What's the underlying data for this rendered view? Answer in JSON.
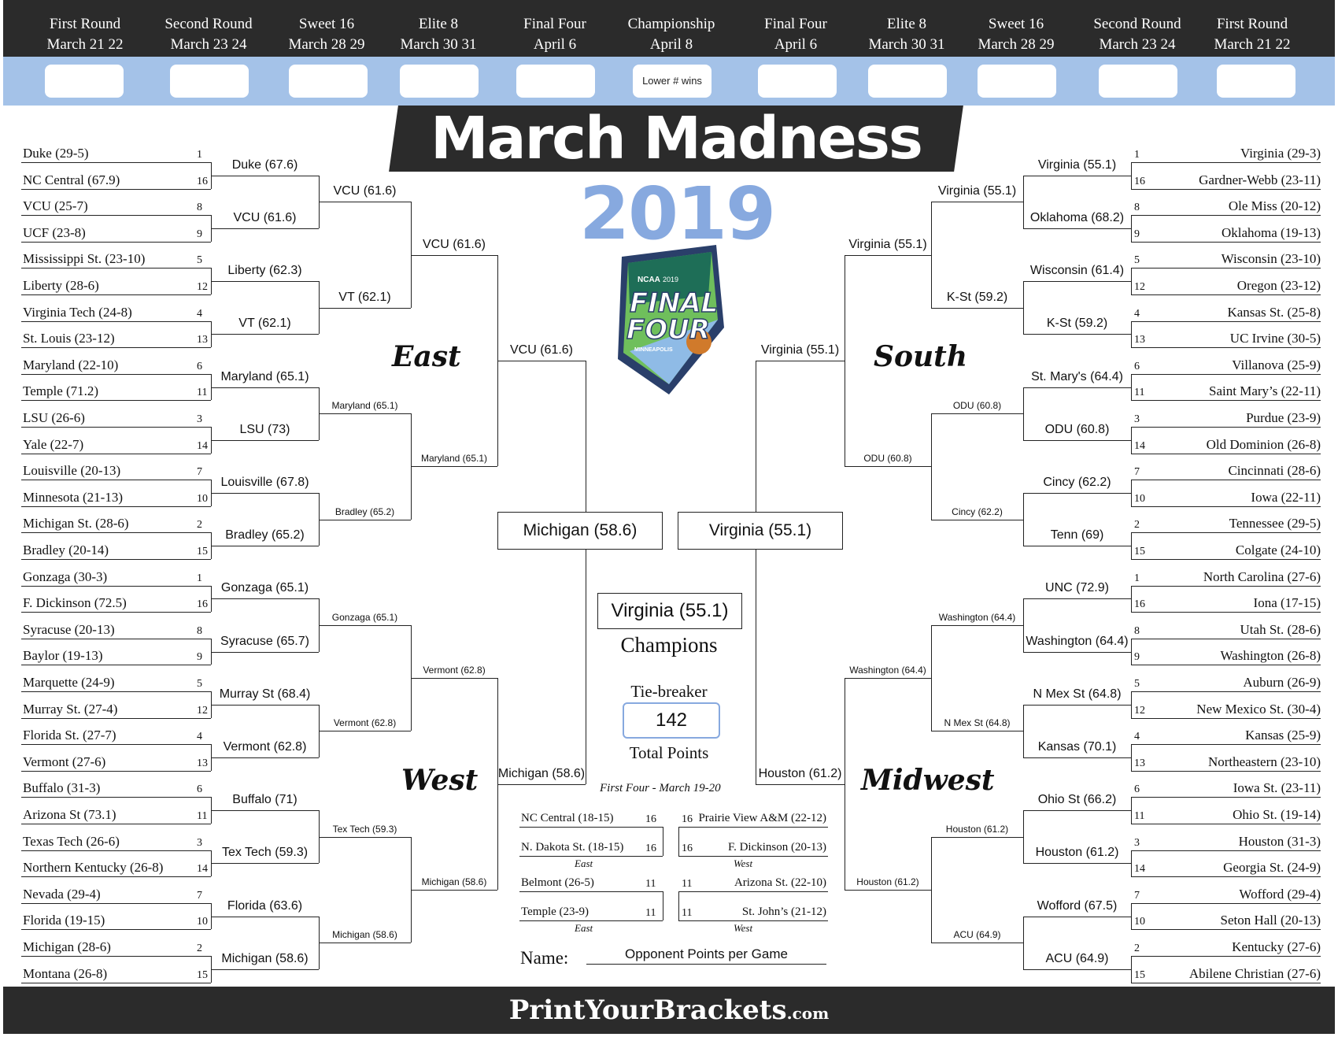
{
  "header": {
    "rounds_left": [
      {
        "name": "First Round",
        "dates": "March 21 22"
      },
      {
        "name": "Second Round",
        "dates": "March 23 24"
      },
      {
        "name": "Sweet 16",
        "dates": "March 28 29"
      },
      {
        "name": "Elite 8",
        "dates": "March 30 31"
      },
      {
        "name": "Final Four",
        "dates": "April 6"
      }
    ],
    "championship": {
      "name": "Championship",
      "dates": "April 8",
      "box_label": "Lower # wins"
    },
    "rounds_right": [
      {
        "name": "Final Four",
        "dates": "April 6"
      },
      {
        "name": "Elite 8",
        "dates": "March 30 31"
      },
      {
        "name": "Sweet 16",
        "dates": "March 28 29"
      },
      {
        "name": "Second Round",
        "dates": "March 23 24"
      },
      {
        "name": "First Round",
        "dates": "March 21 22"
      }
    ]
  },
  "title": {
    "main": "March Madness",
    "year": "2019"
  },
  "logo": {
    "line1": "NCAA",
    "line2": "2019",
    "line3": "FINAL",
    "line4": "FOUR",
    "line5": "MINNEAPOLIS"
  },
  "regions": {
    "east": "East",
    "south": "South",
    "west": "West",
    "midwest": "Midwest"
  },
  "left_teams": [
    {
      "t": "Duke (29-5)",
      "s": "1"
    },
    {
      "t": "NC Central (67.9)",
      "s": "16"
    },
    {
      "t": "VCU (25-7)",
      "s": "8"
    },
    {
      "t": "UCF (23-8)",
      "s": "9"
    },
    {
      "t": "Mississippi St. (23-10)",
      "s": "5"
    },
    {
      "t": "Liberty (28-6)",
      "s": "12"
    },
    {
      "t": "Virginia Tech (24-8)",
      "s": "4"
    },
    {
      "t": "St. Louis (23-12)",
      "s": "13"
    },
    {
      "t": "Maryland (22-10)",
      "s": "6"
    },
    {
      "t": "Temple (71.2)",
      "s": "11"
    },
    {
      "t": "LSU (26-6)",
      "s": "3"
    },
    {
      "t": "Yale (22-7)",
      "s": "14"
    },
    {
      "t": "Louisville (20-13)",
      "s": "7"
    },
    {
      "t": "Minnesota (21-13)",
      "s": "10"
    },
    {
      "t": "Michigan St. (28-6)",
      "s": "2"
    },
    {
      "t": "Bradley (20-14)",
      "s": "15"
    },
    {
      "t": "Gonzaga (30-3)",
      "s": "1"
    },
    {
      "t": "F. Dickinson (72.5)",
      "s": "16"
    },
    {
      "t": "Syracuse (20-13)",
      "s": "8"
    },
    {
      "t": "Baylor (19-13)",
      "s": "9"
    },
    {
      "t": "Marquette (24-9)",
      "s": "5"
    },
    {
      "t": "Murray St. (27-4)",
      "s": "12"
    },
    {
      "t": "Florida St. (27-7)",
      "s": "4"
    },
    {
      "t": "Vermont (27-6)",
      "s": "13"
    },
    {
      "t": "Buffalo (31-3)",
      "s": "6"
    },
    {
      "t": "Arizona St (73.1)",
      "s": "11"
    },
    {
      "t": "Texas Tech (26-6)",
      "s": "3"
    },
    {
      "t": "Northern Kentucky (26-8)",
      "s": "14"
    },
    {
      "t": "Nevada (29-4)",
      "s": "7"
    },
    {
      "t": "Florida (19-15)",
      "s": "10"
    },
    {
      "t": "Michigan (28-6)",
      "s": "2"
    },
    {
      "t": "Montana (26-8)",
      "s": "15"
    }
  ],
  "right_teams": [
    {
      "t": "Virginia (29-3)",
      "s": "1"
    },
    {
      "t": "Gardner-Webb (23-11)",
      "s": "16"
    },
    {
      "t": "Ole Miss (20-12)",
      "s": "8"
    },
    {
      "t": "Oklahoma (19-13)",
      "s": "9"
    },
    {
      "t": "Wisconsin (23-10)",
      "s": "5"
    },
    {
      "t": "Oregon (23-12)",
      "s": "12"
    },
    {
      "t": "Kansas St. (25-8)",
      "s": "4"
    },
    {
      "t": "UC Irvine (30-5)",
      "s": "13"
    },
    {
      "t": "Villanova (25-9)",
      "s": "6"
    },
    {
      "t": "Saint Mary’s (22-11)",
      "s": "11"
    },
    {
      "t": "Purdue (23-9)",
      "s": "3"
    },
    {
      "t": "Old Dominion (26-8)",
      "s": "14"
    },
    {
      "t": "Cincinnati (28-6)",
      "s": "7"
    },
    {
      "t": "Iowa (22-11)",
      "s": "10"
    },
    {
      "t": "Tennessee (29-5)",
      "s": "2"
    },
    {
      "t": "Colgate (24-10)",
      "s": "15"
    },
    {
      "t": "North Carolina (27-6)",
      "s": "1"
    },
    {
      "t": "Iona (17-15)",
      "s": "16"
    },
    {
      "t": "Utah St. (28-6)",
      "s": "8"
    },
    {
      "t": "Washington (26-8)",
      "s": "9"
    },
    {
      "t": "Auburn (26-9)",
      "s": "5"
    },
    {
      "t": "New Mexico St. (30-4)",
      "s": "12"
    },
    {
      "t": "Kansas (25-9)",
      "s": "4"
    },
    {
      "t": "Northeastern (23-10)",
      "s": "13"
    },
    {
      "t": "Iowa St. (23-11)",
      "s": "6"
    },
    {
      "t": "Ohio St. (19-14)",
      "s": "11"
    },
    {
      "t": "Houston (31-3)",
      "s": "3"
    },
    {
      "t": "Georgia St. (24-9)",
      "s": "14"
    },
    {
      "t": "Wofford (29-4)",
      "s": "7"
    },
    {
      "t": "Seton Hall (20-13)",
      "s": "10"
    },
    {
      "t": "Kentucky (27-6)",
      "s": "2"
    },
    {
      "t": "Abilene Christian (27-6)",
      "s": "15"
    }
  ],
  "left_r2": [
    "Duke (67.6)",
    "VCU (61.6)",
    "Liberty (62.3)",
    "VT (62.1)",
    "Maryland (65.1)",
    "LSU (73)",
    "Louisville (67.8)",
    "Bradley (65.2)",
    "Gonzaga (65.1)",
    "Syracuse (65.7)",
    "Murray St (68.4)",
    "Vermont (62.8)",
    "Buffalo (71)",
    "Tex Tech (59.3)",
    "Florida (63.6)",
    "Michigan (58.6)"
  ],
  "left_r3": [
    "VCU (61.6)",
    "VT (62.1)",
    "Maryland (65.1)",
    "Bradley (65.2)",
    "Gonzaga (65.1)",
    "Vermont (62.8)",
    "Tex Tech (59.3)",
    "Michigan (58.6)"
  ],
  "left_r4": [
    "VCU (61.6)",
    "Maryland (65.1)",
    "Vermont (62.8)",
    "Michigan (58.6)"
  ],
  "left_r5": [
    "VCU (61.6)",
    "Michigan (58.6)"
  ],
  "right_r2": [
    "Virginia (55.1)",
    "Oklahoma (68.2)",
    "Wisconsin (61.4)",
    "K-St (59.2)",
    "St. Mary's (64.4)",
    "ODU (60.8)",
    "Cincy (62.2)",
    "Tenn (69)",
    "UNC (72.9)",
    "Washington (64.4)",
    "N Mex St (64.8)",
    "Kansas (70.1)",
    "Ohio St (66.2)",
    "Houston (61.2)",
    "Wofford (67.5)",
    "ACU (64.9)"
  ],
  "right_r3": [
    "Virginia (55.1)",
    "K-St (59.2)",
    "ODU (60.8)",
    "Cincy (62.2)",
    "Washington (64.4)",
    "N Mex St (64.8)",
    "Houston (61.2)",
    "ACU (64.9)"
  ],
  "right_r4": [
    "Virginia (55.1)",
    "ODU (60.8)",
    "Washington (64.4)",
    "Houston (61.2)"
  ],
  "right_r5": [
    "Virginia (55.1)",
    "Houston (61.2)"
  ],
  "final": {
    "left": "Michigan (58.6)",
    "right": "Virginia (55.1)",
    "champion": "Virginia (55.1)",
    "champions_label": "Champions",
    "tiebreaker_label": "Tie-breaker",
    "tiebreaker_value": "142",
    "total_points_label": "Total Points"
  },
  "first_four": {
    "title": "First Four - March 19-20",
    "games": [
      {
        "a": "NC Central (18-15)",
        "as": "16",
        "b": "N. Dakota St. (18-15)",
        "bs": "16",
        "region": "East"
      },
      {
        "a": "Prairie View A&M (22-12)",
        "as": "16",
        "b": "F. Dickinson (20-13)",
        "bs": "16",
        "region": "West"
      },
      {
        "a": "Belmont (26-5)",
        "as": "11",
        "b": "Temple (23-9)",
        "bs": "11",
        "region": "East"
      },
      {
        "a": "Arizona St. (22-10)",
        "as": "11",
        "b": "St. John’s (21-12)",
        "bs": "11",
        "region": "West"
      }
    ]
  },
  "name_field": {
    "label": "Name:",
    "value": "Opponent Points per Game"
  },
  "footer": {
    "brand": "PrintYourBrackets",
    "brand_suffix": ".com"
  },
  "colors": {
    "dark": "#2b2b2b",
    "blue": "#a4c2e8",
    "year_blue": "#87a9df"
  }
}
